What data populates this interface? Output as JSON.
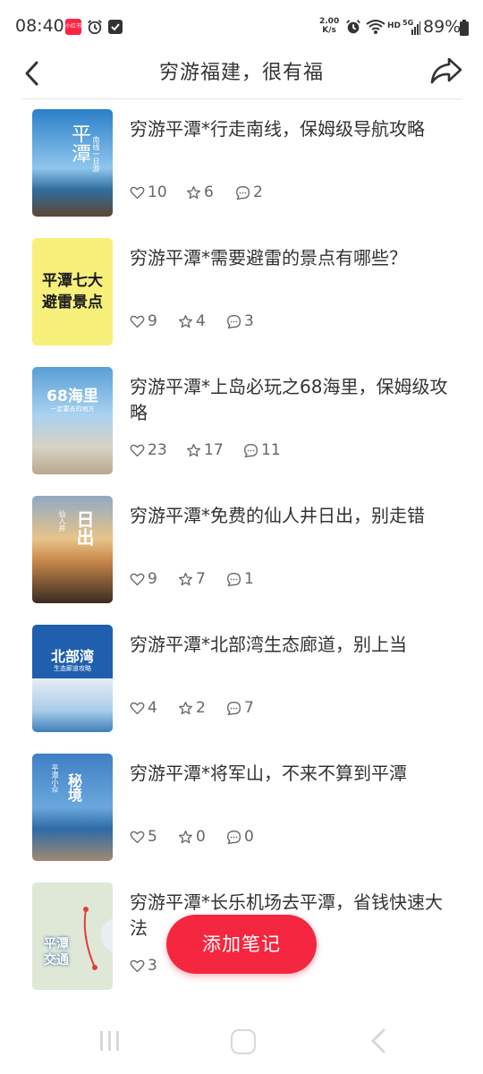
{
  "status_bar": {
    "time": "08:40",
    "app_icon_text": "小红书",
    "speed_top": "2.00",
    "speed_bottom": "K/s",
    "network": "HD",
    "network_gen": "5G",
    "battery": "89%"
  },
  "nav": {
    "title": "穷游福建，很有福"
  },
  "items": [
    {
      "title": "穷游平潭*行走南线，保姆级导航攻略",
      "likes": "10",
      "stars": "6",
      "comments": "2",
      "thumb_text": "平潭",
      "thumb_sub": "南线一日游",
      "bg": "#2a7fc9"
    },
    {
      "title": "穷游平潭*需要避雷的景点有哪些？",
      "likes": "9",
      "stars": "4",
      "comments": "3",
      "thumb_text": "平潭七大避雷景点",
      "thumb_sub": "",
      "bg": "#f7f07a"
    },
    {
      "title": "穷游平潭*上岛必玩之68海里，保姆级攻略",
      "likes": "23",
      "stars": "17",
      "comments": "11",
      "thumb_text": "68海里",
      "thumb_sub": "一定要去的地方",
      "bg": "#5a9fd6"
    },
    {
      "title": "穷游平潭*免费的仙人井日出，别走错",
      "likes": "9",
      "stars": "7",
      "comments": "1",
      "thumb_text": "日出",
      "thumb_sub": "仙人井",
      "bg": "#c9894a"
    },
    {
      "title": "穷游平潭*北部湾生态廊道，别上当",
      "likes": "4",
      "stars": "2",
      "comments": "7",
      "thumb_text": "北部湾",
      "thumb_sub": "生态廊道攻略",
      "bg": "#1f5fae"
    },
    {
      "title": "穷游平潭*将军山，不来不算到平潭",
      "likes": "5",
      "stars": "0",
      "comments": "0",
      "thumb_text": "秘境",
      "thumb_sub": "平潭小众",
      "bg": "#3f7fc4"
    },
    {
      "title": "穷游平潭*长乐机场去平潭，省钱快速大法",
      "likes": "3",
      "stars": "",
      "comments": "",
      "thumb_text": "平潭交通",
      "thumb_sub": "",
      "bg": "#e8eef4"
    }
  ],
  "fab": {
    "label": "添加笔记"
  },
  "colors": {
    "accent": "#f5263f",
    "text": "#333333",
    "muted": "#666666"
  }
}
